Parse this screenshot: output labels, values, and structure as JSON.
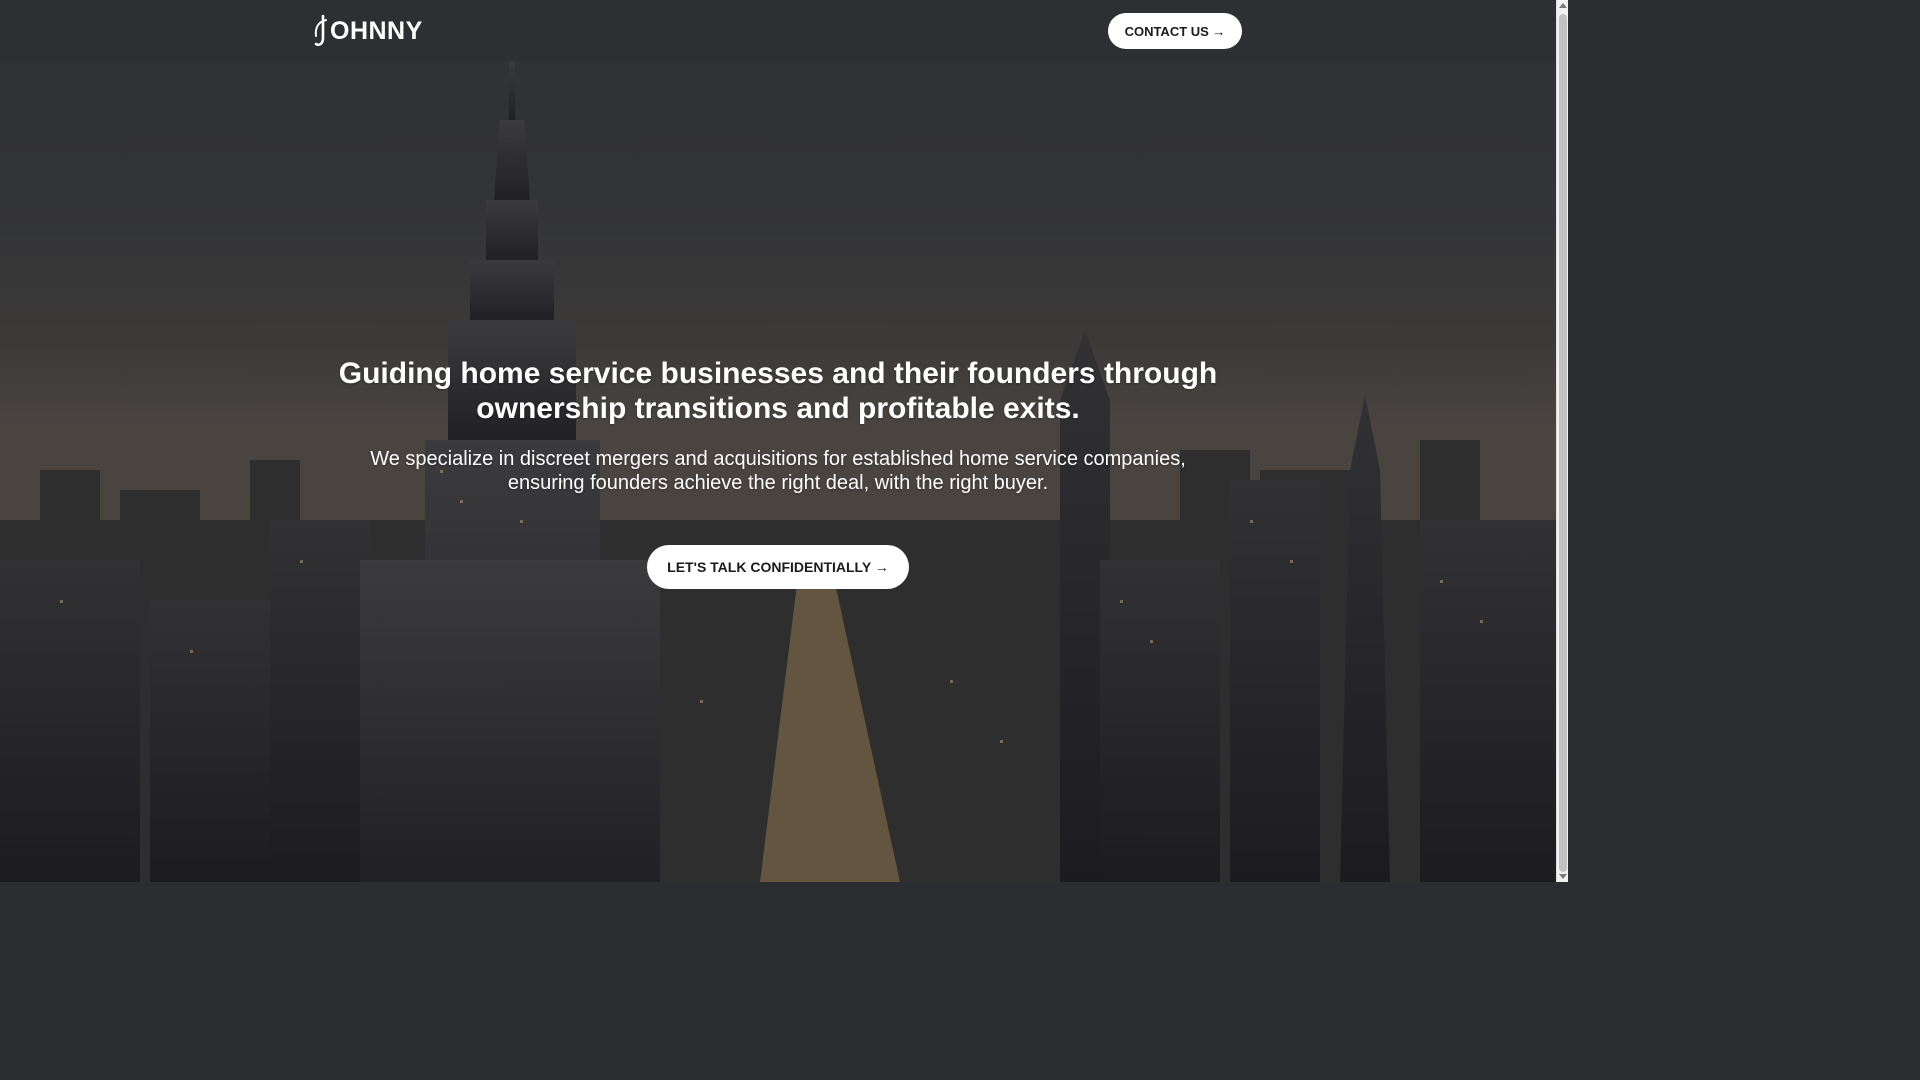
{
  "brand": {
    "logo_text": "OHNNY"
  },
  "header": {
    "contact_label": "CONTACT US →"
  },
  "hero": {
    "title": "Guiding home service businesses and their founders through ownership transitions and profitable exits.",
    "subtitle": "We specialize in discreet mergers and acquisitions for established home service companies, ensuring founders achieve the right deal, with the right buyer.",
    "cta_label": "LET'S TALK CONFIDENTIALLY →",
    "background": "city-skyline-at-dusk"
  },
  "colors": {
    "button_bg": "#ffffff",
    "button_text": "#1b1b1f",
    "text": "#ffffff"
  }
}
